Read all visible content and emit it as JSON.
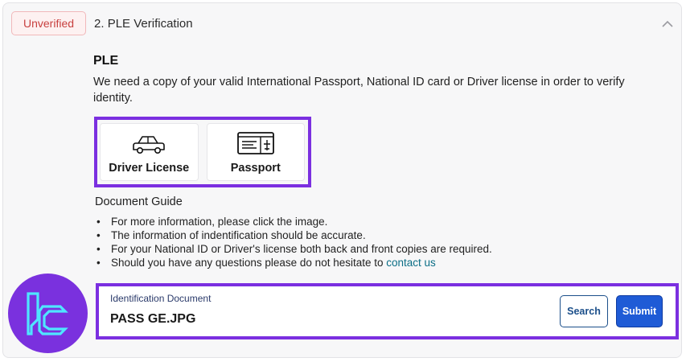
{
  "header": {
    "status_badge": "Unverified",
    "step_title": "2. PLE Verification",
    "collapse_icon": "chevron-up-icon"
  },
  "section": {
    "title": "PLE",
    "description": "We need a copy of your valid International Passport, National ID card or Driver license in order to verify identity."
  },
  "document_options": [
    {
      "label": "Driver License",
      "icon": "car-icon"
    },
    {
      "label": "Passport",
      "icon": "passport-icon"
    }
  ],
  "guide": {
    "title": "Document Guide",
    "items": [
      "For more information, please click the image.",
      "The information of indentification should be accurate.",
      "For your National ID or Driver's license both back and front copies are required.",
      "Should you have any questions please do not hesitate to "
    ],
    "contact_link": "contact us"
  },
  "upload": {
    "label": "Identification Document",
    "value": "PASS GE.JPG",
    "search_label": "Search",
    "submit_label": "Submit"
  },
  "colors": {
    "accent_purple": "#7b2fe0",
    "unverified_red": "#c8403f",
    "submit_blue": "#1f5bd6",
    "logo_cyan": "#3fe0ff"
  }
}
